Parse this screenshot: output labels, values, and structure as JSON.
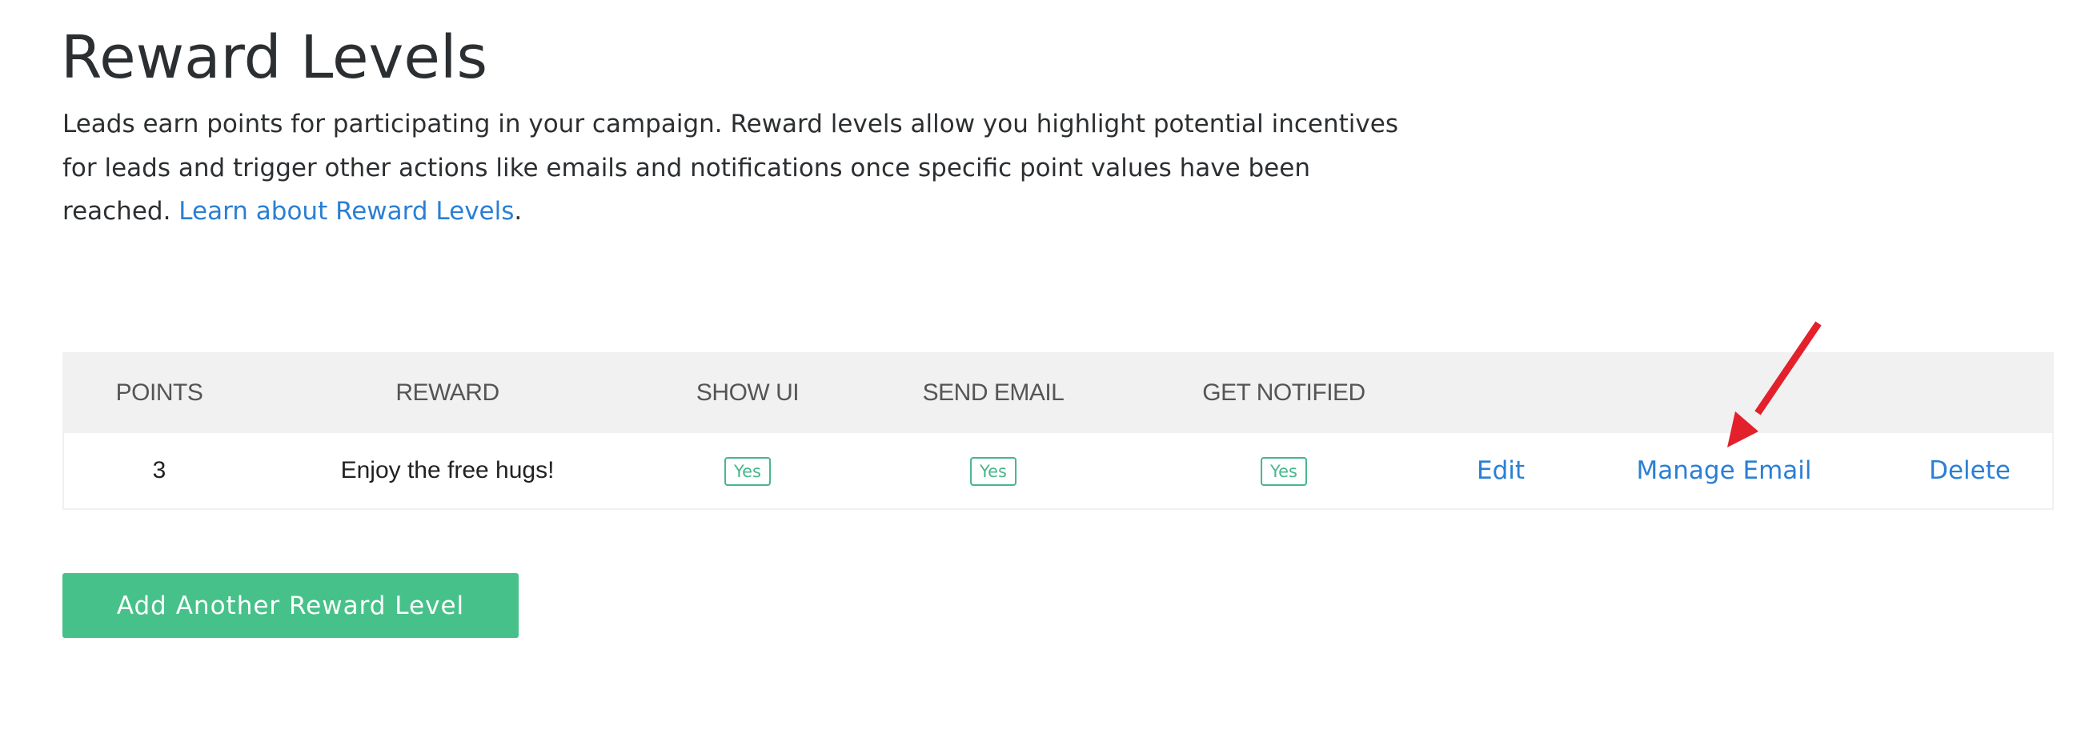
{
  "page": {
    "title": "Reward Levels",
    "description": {
      "text": "Leads earn points for participating in your campaign. Reward levels allow you highlight potential incentives for leads and trigger other actions like emails and notifications once specific point values have been reached.",
      "link_label": "Learn about Reward Levels",
      "trailing": "."
    }
  },
  "table": {
    "columns": [
      "POINTS",
      "REWARD",
      "SHOW UI",
      "SEND EMAIL",
      "GET NOTIFIED"
    ],
    "rows": [
      {
        "points": "3",
        "reward": "Enjoy the free hugs!",
        "show_ui": "Yes",
        "send_email": "Yes",
        "get_notified": "Yes",
        "actions": {
          "edit": "Edit",
          "manage_email": "Manage Email",
          "delete": "Delete"
        }
      }
    ]
  },
  "buttons": {
    "add_reward_level": "Add Another Reward Level"
  },
  "annotation": {
    "type": "arrow",
    "points_to": "Manage Email",
    "color": "#e3202b"
  },
  "colors": {
    "link": "#2a7fd4",
    "primary_button": "#47c18a",
    "badge": "#47b68a",
    "table_header_bg": "#f1f1f1",
    "text": "#2c2f31"
  }
}
